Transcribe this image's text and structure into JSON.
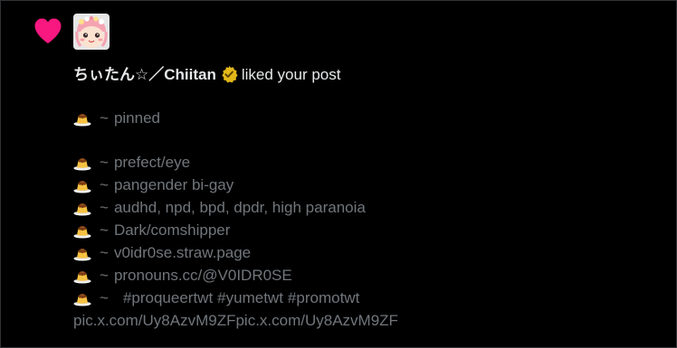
{
  "notification": {
    "type_icon": "heart-icon",
    "type_color": "#f91880",
    "user": {
      "display_name": "ちぃたん☆／Chiitan",
      "verified_badge": "gold-verified-badge-icon",
      "badge_color": "#e2b719"
    },
    "action_text": "liked your post"
  },
  "post": {
    "line_icon": "custard-pudding-emoji",
    "pinned": "pinned",
    "bio_lines": [
      "prefect/eye",
      "pangender bi-gay",
      "audhd, npd, bpd, dpdr, high paranoia",
      "Dark/comshipper",
      "v0idr0se.straw.page",
      "pronouns.cc/@V0IDR0SE"
    ],
    "tilde": "~",
    "hashtags": [
      "#proqueertwt",
      "#yumetwt",
      "#promotwt"
    ],
    "trailing_link": "pic.x.com/Uy8AzvM9ZFpic.x.com/Uy8AzvM9ZF"
  },
  "colors": {
    "background": "#000000",
    "primary_text": "#e7e9ea",
    "secondary_text": "#71767b"
  }
}
